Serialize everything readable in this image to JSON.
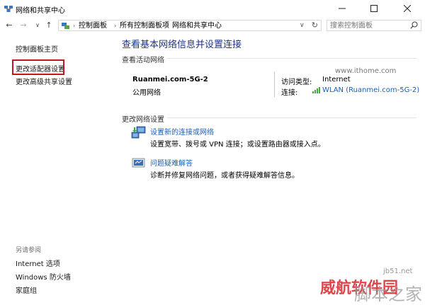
{
  "window": {
    "title": "网络和共享中心"
  },
  "nav": {
    "back": "←",
    "forward": "→",
    "dropdown": "∨",
    "up": "↑"
  },
  "breadcrumb": [
    "控制面板",
    "所有控制面板项",
    "网络和共享中心"
  ],
  "search": {
    "placeholder": "搜索控制面板"
  },
  "sidebar": {
    "items": [
      {
        "label": "控制面板主页"
      },
      {
        "label": "更改适配器设置"
      },
      {
        "label": "更改高级共享设置"
      }
    ],
    "see_also_title": "另请参阅",
    "see_also": [
      {
        "label": "Internet 选项"
      },
      {
        "label": "Windows 防火墙"
      },
      {
        "label": "家庭组"
      }
    ]
  },
  "main": {
    "title": "查看基本网络信息并设置连接",
    "active_networks_label": "查看活动网络",
    "watermark_site": "www.ithome.com",
    "network": {
      "name": "Ruanmei.com-5G-2",
      "type": "公用网络",
      "access_type_label": "访问类型:",
      "access_type_value": "Internet",
      "connection_label": "连接:",
      "connection_value": "WLAN (Ruanmei.com-5G-2)"
    },
    "change_settings_label": "更改网络设置",
    "actions": [
      {
        "title": "设置新的连接或网络",
        "description": "设置宽带、拨号或 VPN 连接；或设置路由器或接入点。",
        "icon": "network-setup-icon"
      },
      {
        "title": "问题疑难解答",
        "description": "诊断并修复网络问题，或者获得疑难解答信息。",
        "icon": "troubleshoot-icon"
      }
    ]
  },
  "watermarks": {
    "jb51": "jb51.net",
    "big": "脚本之家",
    "red": "威航软件园"
  },
  "colors": {
    "title_blue": "#1e3287",
    "link_blue": "#1a5fb4",
    "highlight_red": "#c4161c"
  }
}
